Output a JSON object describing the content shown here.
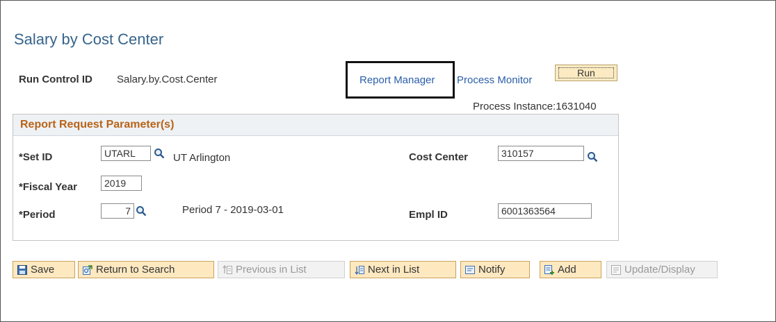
{
  "page": {
    "title": "Salary by Cost Center"
  },
  "run_control": {
    "label": "Run Control ID",
    "value": "Salary.by.Cost.Center"
  },
  "links": {
    "report_manager": "Report Manager",
    "process_monitor": "Process Monitor"
  },
  "run_button": "Run",
  "process_instance": "Process Instance:1631040",
  "group": {
    "title": "Report Request Parameter(s)",
    "set_id": {
      "label": "*Set ID",
      "value": "UTARL",
      "description": "UT Arlington"
    },
    "fiscal_year": {
      "label": "*Fiscal Year",
      "value": "2019"
    },
    "period": {
      "label": "*Period",
      "value": "7",
      "description": "Period 7 - 2019-03-01"
    },
    "cost_center": {
      "label": "Cost Center",
      "value": "310157"
    },
    "empl_id": {
      "label": "Empl ID",
      "value": "6001363564"
    }
  },
  "toolbar": {
    "save": "Save",
    "return_to_search": "Return to Search",
    "previous_in_list": "Previous in List",
    "next_in_list": "Next in List",
    "notify": "Notify",
    "add": "Add",
    "update_display": "Update/Display"
  },
  "colors": {
    "title": "#36648b",
    "link": "#2a5ea8",
    "group_title": "#b86319",
    "button_bg": "#fde8c0"
  },
  "icons": [
    "lookup-icon",
    "save-icon",
    "return-to-search-icon",
    "previous-in-list-icon",
    "next-in-list-icon",
    "notify-icon",
    "add-icon",
    "update-display-icon"
  ]
}
